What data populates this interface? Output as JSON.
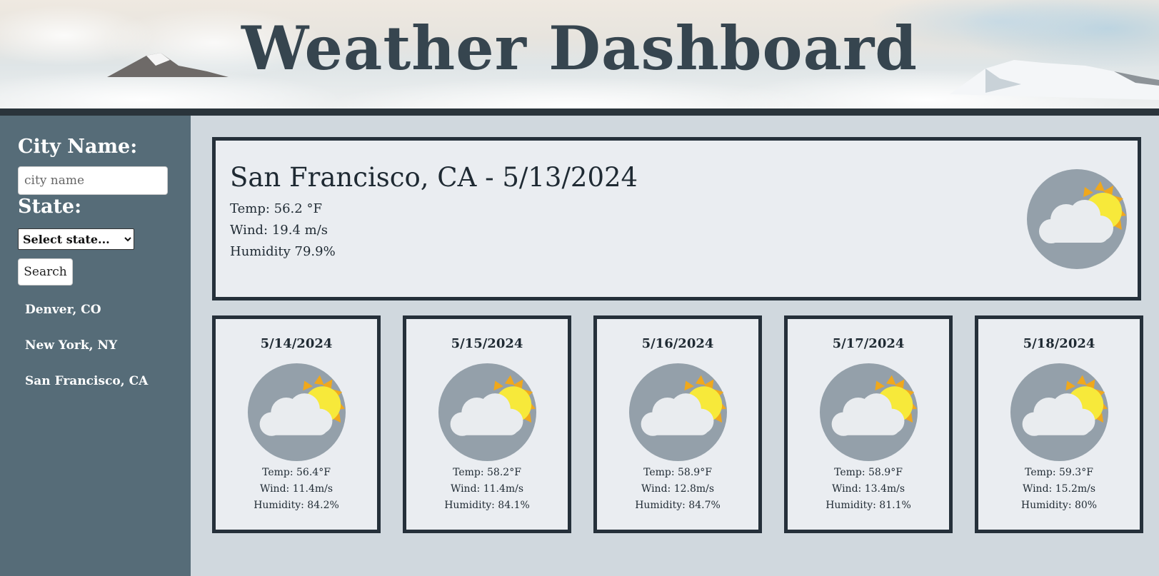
{
  "header": {
    "title": "Weather Dashboard"
  },
  "sidebar": {
    "city_label": "City Name:",
    "city_input": {
      "value": "",
      "placeholder": "city name"
    },
    "state_label": "State:",
    "state_select": {
      "selected": "Select state..."
    },
    "search_label": "Search",
    "history": [
      "Denver, CO",
      "New York, NY",
      "San Francisco, CA"
    ]
  },
  "current": {
    "city_date": "San Francisco, CA - 5/13/2024",
    "temp": "Temp: 56.2 °F",
    "wind": "Wind: 19.4 m/s",
    "humidity": "Humidity 79.9%",
    "icon": "partly-cloudy-icon"
  },
  "forecast": [
    {
      "date": "5/14/2024",
      "temp": "Temp: 56.4°F",
      "wind": "Wind: 11.4m/s",
      "humidity": "Humidity: 84.2%",
      "icon": "partly-cloudy-icon"
    },
    {
      "date": "5/15/2024",
      "temp": "Temp: 58.2°F",
      "wind": "Wind: 11.4m/s",
      "humidity": "Humidity: 84.1%",
      "icon": "partly-cloudy-icon"
    },
    {
      "date": "5/16/2024",
      "temp": "Temp: 58.9°F",
      "wind": "Wind: 12.8m/s",
      "humidity": "Humidity: 84.7%",
      "icon": "partly-cloudy-icon"
    },
    {
      "date": "5/17/2024",
      "temp": "Temp: 58.9°F",
      "wind": "Wind: 13.4m/s",
      "humidity": "Humidity: 81.1%",
      "icon": "partly-cloudy-icon"
    },
    {
      "date": "5/18/2024",
      "temp": "Temp: 59.3°F",
      "wind": "Wind: 15.2m/s",
      "humidity": "Humidity: 80%",
      "icon": "partly-cloudy-icon"
    }
  ],
  "colors": {
    "title": "#36454f",
    "sidebar_bg": "#566c78",
    "main_bg": "#d0d8de",
    "card_bg": "#eaedf1",
    "card_border": "#25303a",
    "icon_circle": "#94a0aa",
    "sun": "#f7e93a",
    "sun_rays": "#f0a81c"
  }
}
